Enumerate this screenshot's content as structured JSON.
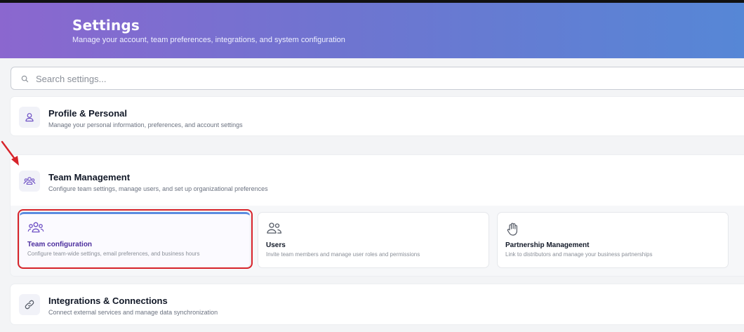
{
  "header": {
    "title": "Settings",
    "subtitle": "Manage your account, team preferences, integrations, and system configuration"
  },
  "search": {
    "placeholder": "Search settings...",
    "value": ""
  },
  "sections": {
    "profile": {
      "icon": "user-icon",
      "title": "Profile & Personal",
      "description": "Manage your personal information, preferences, and account settings"
    },
    "team": {
      "icon": "team-icon",
      "title": "Team Management",
      "description": "Configure team settings, manage users, and set up organizational preferences",
      "items": [
        {
          "icon": "team-icon",
          "title": "Team configuration",
          "description": "Configure team-wide settings, email preferences, and business hours",
          "active": true
        },
        {
          "icon": "users-icon",
          "title": "Users",
          "description": "Invite team members and manage user roles and permissions",
          "active": false
        },
        {
          "icon": "hand-icon",
          "title": "Partnership Management",
          "description": "Link to distributors and manage your business partnerships",
          "active": false
        }
      ]
    },
    "integrations": {
      "icon": "link-icon",
      "title": "Integrations & Connections",
      "description": "Connect external services and manage data synchronization"
    }
  },
  "colors": {
    "header_gradient_start": "#8b67cf",
    "header_gradient_end": "#5687d6",
    "accent_purple": "#4c2e9e",
    "active_top_border": "#5b8be0",
    "annotation_red": "#d7232a"
  }
}
